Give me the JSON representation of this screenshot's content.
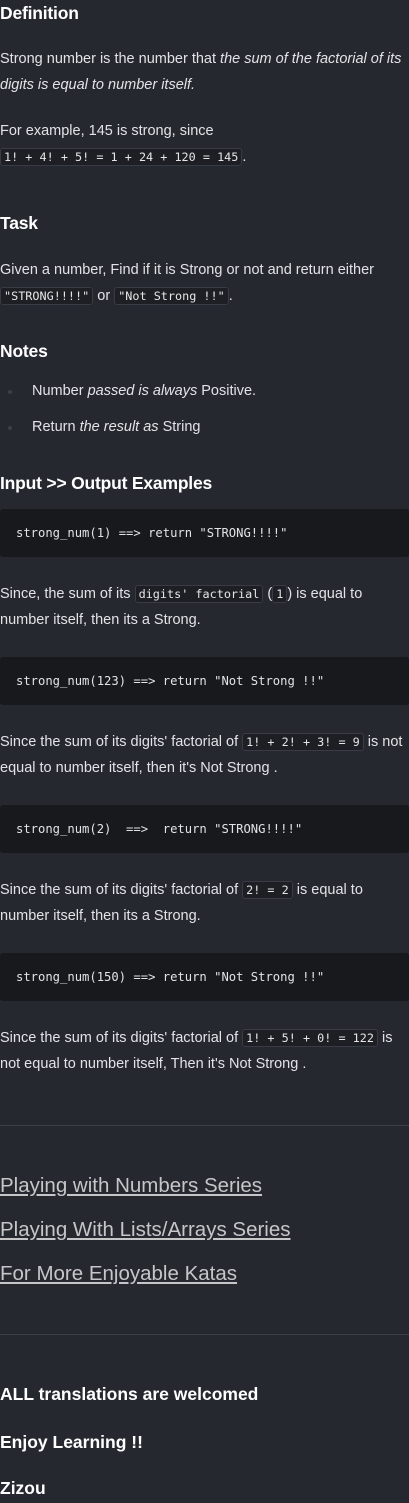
{
  "definition": {
    "heading": "Definition",
    "p1_a": "Strong number is the number that ",
    "p1_em": "the sum of the factorial of its digits is equal to number itself.",
    "p2_a": "For example, 145 is strong, since",
    "p2_code": "1! + 4! + 5! = 1 + 24 + 120 = 145",
    "p2_end": "."
  },
  "task": {
    "heading": "Task",
    "text_a": "Given a number, Find if it is Strong or not and return either",
    "code1": "\"STRONG!!!!\"",
    "or": " or ",
    "code2": "\"Not Strong !!\"",
    "end": "."
  },
  "notes": {
    "heading": "Notes",
    "items": [
      {
        "a": "Number ",
        "em": "passed is always",
        "b": " Positive."
      },
      {
        "a": "Return ",
        "em": "the result as",
        "b": " String"
      }
    ]
  },
  "examples": {
    "heading": "Input >> Output Examples",
    "ex1_code": "strong_num(1) ==> return \"STRONG!!!!\"",
    "ex1_text_a": "Since, the sum of its ",
    "ex1_code_a": "digits' factorial",
    "ex1_text_b": " (",
    "ex1_code_b": "1",
    "ex1_text_c": ") is equal to number itself, then its a Strong.",
    "ex2_code": "strong_num(123) ==> return \"Not Strong !!\"",
    "ex2_text_a": "Since the sum of its digits' factorial of ",
    "ex2_code_a": "1! + 2! + 3! = 9",
    "ex2_text_b": " is not equal to number itself, then it's Not Strong .",
    "ex3_code": "strong_num(2)  ==>  return \"STRONG!!!!\"",
    "ex3_text_a": "Since the sum of its digits' factorial of ",
    "ex3_code_a": "2! = 2",
    "ex3_text_b": " is equal to number itself, then its a Strong.",
    "ex4_code": "strong_num(150) ==> return \"Not Strong !!\"",
    "ex4_text_a": "Since the sum of its digits' factorial of ",
    "ex4_code_a": "1! + 5! + 0! = 122",
    "ex4_text_b": " is not equal to number itself, Then it's Not Strong ."
  },
  "links": [
    "Playing with Numbers Series",
    "Playing With Lists/Arrays Series",
    "For More Enjoyable Katas"
  ],
  "footer": {
    "line1": "ALL translations are welcomed",
    "line2": "Enjoy Learning !!",
    "line3": "Zizou"
  },
  "colors": {
    "background": "#262830",
    "code_block": "#18191d",
    "link": "#c6c6c9"
  }
}
